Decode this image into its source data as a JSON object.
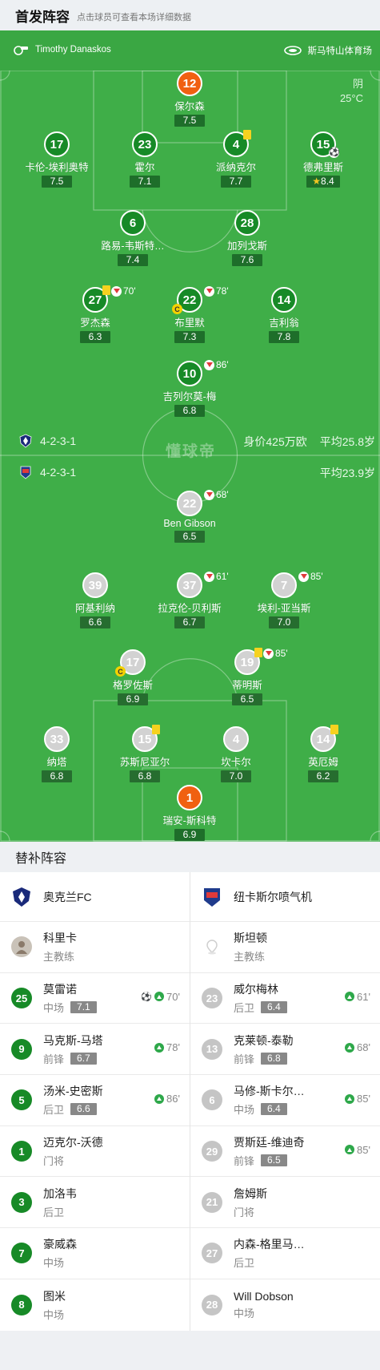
{
  "header": {
    "title": "首发阵容",
    "subtitle": "点击球员可查看本场详细数据"
  },
  "match": {
    "referee": "Timothy Danaskos",
    "venue": "斯马特山体育场",
    "weather": "阴",
    "temperature": "25°C"
  },
  "home": {
    "formation": "4-2-3-1",
    "value": "身价425万欧",
    "avg_age": "平均25.8岁"
  },
  "away": {
    "formation": "4-2-3-1",
    "avg_age": "平均23.9岁"
  },
  "watermark": "懂球帝",
  "home_players": [
    {
      "num": "12",
      "name": "保尔森",
      "rating": "7.5"
    },
    {
      "num": "17",
      "name": "卡伦-埃利奥特",
      "rating": "7.5"
    },
    {
      "num": "23",
      "name": "霍尔",
      "rating": "7.1"
    },
    {
      "num": "4",
      "name": "派纳克尔",
      "rating": "7.7"
    },
    {
      "num": "15",
      "name": "德弗里斯",
      "rating": "8.4"
    },
    {
      "num": "6",
      "name": "路易-韦斯特…",
      "rating": "7.4"
    },
    {
      "num": "28",
      "name": "加列戈斯",
      "rating": "7.6"
    },
    {
      "num": "27",
      "name": "罗杰森",
      "rating": "6.3",
      "sub": "70'"
    },
    {
      "num": "22",
      "name": "布里默",
      "rating": "7.3",
      "sub": "78'"
    },
    {
      "num": "14",
      "name": "吉利翁",
      "rating": "7.8"
    },
    {
      "num": "10",
      "name": "吉列尔莫-梅",
      "rating": "6.8",
      "sub": "86'"
    }
  ],
  "away_players": [
    {
      "num": "22",
      "name": "Ben Gibson",
      "rating": "6.5",
      "sub": "68'"
    },
    {
      "num": "39",
      "name": "阿基利纳",
      "rating": "6.6"
    },
    {
      "num": "37",
      "name": "拉克伦-贝利斯",
      "rating": "6.7",
      "sub": "61'"
    },
    {
      "num": "7",
      "name": "埃利-亚当斯",
      "rating": "7.0",
      "sub": "85'"
    },
    {
      "num": "17",
      "name": "格罗佐斯",
      "rating": "6.9"
    },
    {
      "num": "19",
      "name": "蒂明斯",
      "rating": "6.5",
      "sub": "85'"
    },
    {
      "num": "33",
      "name": "纳塔",
      "rating": "6.8"
    },
    {
      "num": "15",
      "name": "苏斯尼亚尔",
      "rating": "6.8"
    },
    {
      "num": "4",
      "name": "坎卡尔",
      "rating": "7.0"
    },
    {
      "num": "14",
      "name": "英厄姆",
      "rating": "6.2"
    },
    {
      "num": "1",
      "name": "瑞安-斯科特",
      "rating": "6.9"
    }
  ],
  "subs": {
    "title": "替补阵容",
    "home_team": "奥克兰FC",
    "away_team": "纽卡斯尔喷气机",
    "home_coach": {
      "name": "科里卡",
      "role": "主教练"
    },
    "away_coach": {
      "name": "斯坦顿",
      "role": "主教练"
    },
    "home": [
      {
        "num": "25",
        "name": "莫雷诺",
        "pos": "中场",
        "rating": "7.1",
        "min": "70'"
      },
      {
        "num": "9",
        "name": "马克斯-马塔",
        "pos": "前锋",
        "rating": "6.7",
        "min": "78'"
      },
      {
        "num": "5",
        "name": "汤米-史密斯",
        "pos": "后卫",
        "rating": "6.6",
        "min": "86'"
      },
      {
        "num": "1",
        "name": "迈克尔-沃德",
        "pos": "门将"
      },
      {
        "num": "3",
        "name": "加洛韦",
        "pos": "后卫"
      },
      {
        "num": "7",
        "name": "豪威森",
        "pos": "中场"
      },
      {
        "num": "8",
        "name": "图米",
        "pos": "中场"
      }
    ],
    "away": [
      {
        "num": "23",
        "name": "威尔梅林",
        "pos": "后卫",
        "rating": "6.4",
        "min": "61'"
      },
      {
        "num": "13",
        "name": "克莱顿-泰勒",
        "pos": "前锋",
        "rating": "6.8",
        "min": "68'"
      },
      {
        "num": "6",
        "name": "马修-斯卡尔…",
        "pos": "中场",
        "rating": "6.4",
        "min": "85'"
      },
      {
        "num": "29",
        "name": "贾斯廷-维迪奇",
        "pos": "前锋",
        "rating": "6.5",
        "min": "85'"
      },
      {
        "num": "21",
        "name": "詹姆斯",
        "pos": "门将"
      },
      {
        "num": "27",
        "name": "内森-格里马…",
        "pos": "后卫"
      },
      {
        "num": "28",
        "name": "Will Dobson",
        "pos": "中场"
      }
    ]
  }
}
